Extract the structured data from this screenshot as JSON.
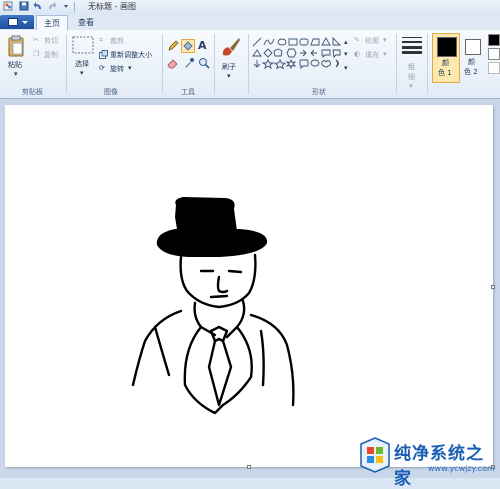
{
  "window": {
    "title": "无标题 - 画图"
  },
  "tabs": {
    "home": "主页",
    "view": "查看"
  },
  "clipboard": {
    "paste": "粘贴",
    "cut": "剪切",
    "copy": "复制",
    "group_label": "剪贴板"
  },
  "image": {
    "select": "选择",
    "crop": "裁剪",
    "resize": "重新调整大小",
    "rotate": "旋转",
    "group_label": "图像"
  },
  "tools": {
    "group_label": "工具",
    "text_glyph": "A"
  },
  "brushes": {
    "label": "刷子"
  },
  "shapes": {
    "outline": "轮廓",
    "fill": "填充",
    "group_label": "形状"
  },
  "size": {
    "label_line1": "粗",
    "label_line2": "细"
  },
  "colors": {
    "color1_line1": "颜",
    "color1_line2": "色 1",
    "color2_line1": "颜",
    "color2_line2": "色 2",
    "color1_value": "#000000",
    "color2_value": "#ffffff",
    "accent": "#1a5fb4"
  },
  "watermark": {
    "title": "纯净系统之家",
    "url": "www.ycwjzy.com"
  }
}
